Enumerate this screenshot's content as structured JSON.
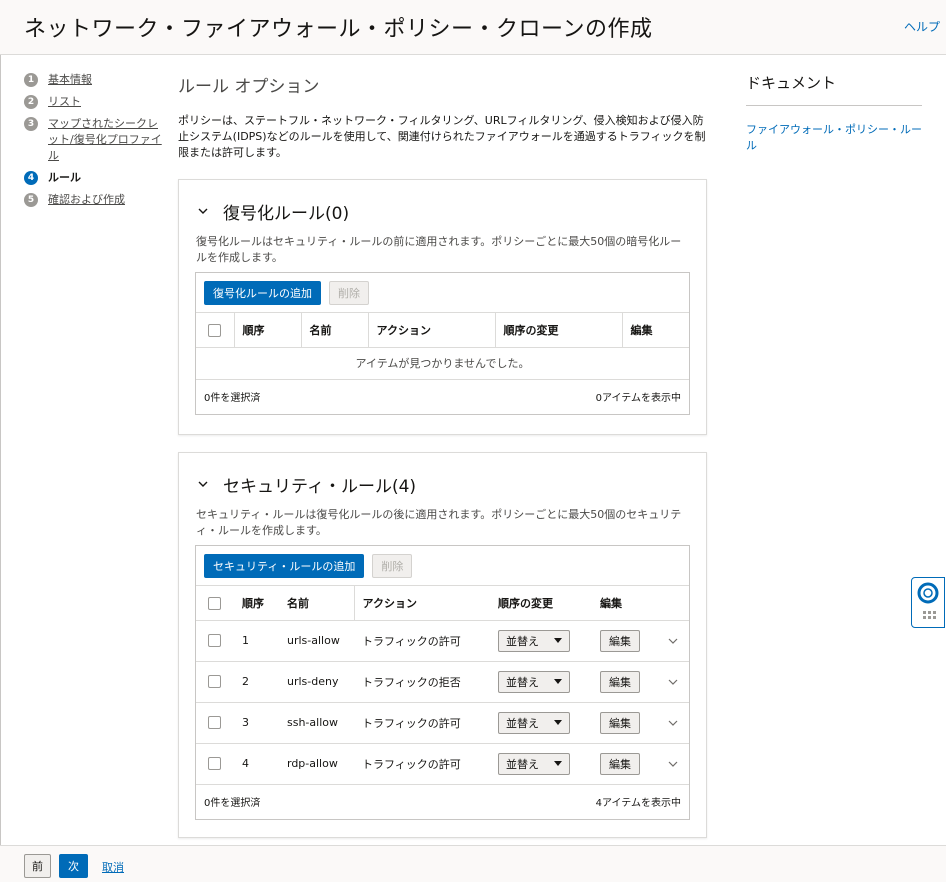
{
  "header": {
    "title": "ネットワーク・ファイアウォール・ポリシー・クローンの作成",
    "help": "ヘルプ"
  },
  "steps": [
    {
      "num": "1",
      "label": "基本情報"
    },
    {
      "num": "2",
      "label": "リスト"
    },
    {
      "num": "3",
      "label": "マップされたシークレット/復号化プロファイル"
    },
    {
      "num": "4",
      "label": "ルール"
    },
    {
      "num": "5",
      "label": "確認および作成"
    }
  ],
  "main": {
    "section_title": "ルール オプション",
    "intro": "ポリシーは、ステートフル・ネットワーク・フィルタリング、URLフィルタリング、侵入検知および侵入防止システム(IDPS)などのルールを使用して、関連付けられたファイアウォールを通過するトラフィックを制限または許可します。"
  },
  "decryption": {
    "title": "復号化ルール(0)",
    "desc": "復号化ルールはセキュリティ・ルールの前に適用されます。ポリシーごとに最大50個の暗号化ルールを作成します。",
    "add_button": "復号化ルールの追加",
    "delete_button": "削除",
    "columns": [
      "順序",
      "名前",
      "アクション",
      "順序の変更",
      "編集"
    ],
    "empty": "アイテムが見つかりませんでした。",
    "selected": "0件を選択済",
    "showing": "0アイテムを表示中"
  },
  "security": {
    "title": "セキュリティ・ルール(4)",
    "desc": "セキュリティ・ルールは復号化ルールの後に適用されます。ポリシーごとに最大50個のセキュリティ・ルールを作成します。",
    "add_button": "セキュリティ・ルールの追加",
    "delete_button": "削除",
    "columns": [
      "順序",
      "名前",
      "アクション",
      "順序の変更",
      "編集"
    ],
    "rows": [
      {
        "order": "1",
        "name": "urls-allow",
        "action": "トラフィックの許可",
        "reorder": "並替え",
        "edit": "編集"
      },
      {
        "order": "2",
        "name": "urls-deny",
        "action": "トラフィックの拒否",
        "reorder": "並替え",
        "edit": "編集"
      },
      {
        "order": "3",
        "name": "ssh-allow",
        "action": "トラフィックの許可",
        "reorder": "並替え",
        "edit": "編集"
      },
      {
        "order": "4",
        "name": "rdp-allow",
        "action": "トラフィックの許可",
        "reorder": "並替え",
        "edit": "編集"
      }
    ],
    "selected": "0件を選択済",
    "showing": "4アイテムを表示中"
  },
  "docs": {
    "title": "ドキュメント",
    "link": "ファイアウォール・ポリシー・ルール"
  },
  "footer": {
    "prev": "前",
    "next": "次",
    "cancel": "取消"
  },
  "colors": {
    "accent": "#006bb8",
    "header_bg": "#fbf9f8"
  }
}
